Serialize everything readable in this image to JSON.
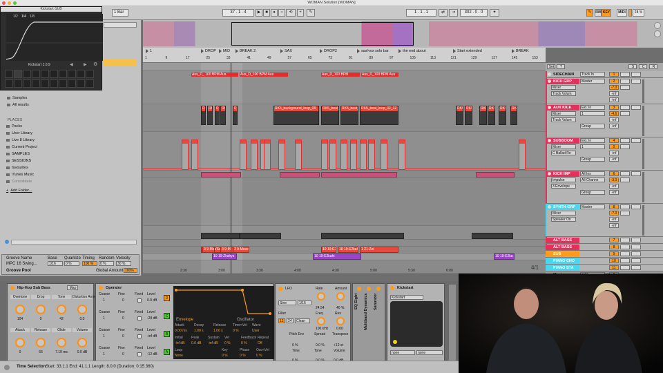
{
  "window": {
    "title": "WOMAN Solution  [WOMAN]"
  },
  "transport": {
    "bar_select": "1 Bar",
    "position": "37 .  1 .  4",
    "loop_start": "1 .  1 .  1",
    "loop_length": "302 .  0 .  0",
    "key_label": "KEY",
    "midi_label": "MIDI",
    "cpu": "28 %"
  },
  "kickstart_float": {
    "title": "Kickstart·SUB",
    "name": "Kickstart 1.0.9",
    "rate_labels": [
      "1/2",
      "1/4",
      "1/8"
    ]
  },
  "browser": {
    "search_placeholder": "",
    "items": [
      {
        "label": "Samples"
      },
      {
        "label": "All results"
      }
    ],
    "places_header": "PLACES",
    "places": [
      "Packs",
      "User Library",
      "Live 8 Library",
      "Current Project",
      "SAMPLES",
      "SESSIONS",
      "favourites",
      "iTunes Music",
      "Consolidate"
    ],
    "add_folder": "Add Folder...",
    "groove_headers": [
      "Groove Name",
      "Base",
      "Quantize",
      "Timing",
      "Random",
      "Velocity"
    ],
    "groove_row": {
      "name": "MPC 16 Swing...",
      "base": "1/16",
      "quantize": "0 %",
      "timing": "100 %",
      "random": "0 %",
      "velocity": "30 %"
    },
    "groove_pool": "Groove Pool",
    "global_amount_label": "Global Amount",
    "global_amount": "100%"
  },
  "ruler": {
    "bars": [
      "1",
      "9",
      "17",
      "25",
      "33",
      "41",
      "49",
      "57",
      "65",
      "73",
      "81",
      "89",
      "97",
      "105",
      "113",
      "121",
      "129",
      "137",
      "145",
      "153"
    ],
    "locators": [
      "1",
      "DROP",
      "MID",
      "BREAK 2",
      "SAX",
      "DROP2",
      "sax/vox solo bar",
      "the end about",
      "Start extended",
      "BREAK"
    ]
  },
  "arrangement": {
    "audio_clip_labels": [
      "Aus_D_ 100 BPM Aus",
      "Aus_D_100 BPM Aus",
      "Aus_D_100 BPM",
      "Aus_D_100 BPM Aus"
    ],
    "loop_labels": [
      "R",
      "RK5_",
      "R",
      "RK5",
      "R",
      "RK5_background_loop_08",
      "RK5_beat_",
      "RK5_beat_",
      "RK5_beat_loop_02_12",
      "RK5",
      "RK5",
      "RK5",
      "RK5",
      "RK5",
      "RK5_"
    ],
    "bottom_labels": [
      "04_Drop/Su",
      "3 9-Mos",
      "3 9-Mos",
      "3 9-Mosek",
      "10 19-E2kah",
      "10 19-E2kahi",
      "1 21-Zei",
      "10 19-Zkahys",
      "10 19-E2kahi",
      "10 19-E2ka"
    ],
    "page_counter": "4/1",
    "timeline": [
      "2:30",
      "3:00",
      "3:30",
      "4:00",
      "4:30",
      "5:00",
      "5:30",
      "6:00"
    ]
  },
  "mixer": {
    "top_buttons": [
      "Set",
      "?",
      "S",
      "C",
      "R"
    ],
    "tracks": [
      {
        "name": "SIDECHAIN",
        "color": "#e2325c",
        "input": "Track In",
        "num": "1"
      },
      {
        "name": "KICK GRP",
        "color": "#e2325c",
        "input": "Master",
        "num": "2",
        "sub": [
          "Mixer",
          "Track Volum"
        ],
        "vol": "-7.0",
        "vals": [
          "-inf",
          "-inf"
        ]
      },
      {
        "name": "AUX KICK",
        "color": "#e2325c",
        "input": "Ext. In",
        "num": "3",
        "sub": [
          "Mixer",
          "Track Volum"
        ],
        "vol": "-4.6",
        "vals": [
          "-inf",
          "-inf"
        ],
        "chan": "1",
        "grp": "Group"
      },
      {
        "name": "SUBBOOM",
        "color": "#e2325c",
        "input": "Ext. In",
        "num": "4",
        "sub": [
          "Mixer",
          "C Ballad Re"
        ],
        "vol": "0",
        "vals": [
          "-inf",
          "-inf"
        ],
        "chan": "1",
        "grp": "Group"
      },
      {
        "name": "KICK IMP",
        "color": "#e2325c",
        "input": "All Ins",
        "num": "6",
        "sub": [
          "Impulse",
          "3 Envelope"
        ],
        "vol": "-3.0",
        "vals": [
          "-inf",
          "-inf"
        ],
        "chan": "All Channe",
        "grp": "Group"
      },
      {
        "name": "SYNTH GRP",
        "color": "#4ad6ee",
        "input": "Master",
        "num": "8",
        "sub": [
          "Mixer",
          "Speaker On"
        ],
        "vol": "-7.0",
        "vals": [
          "-inf",
          "-inf"
        ]
      }
    ],
    "compact": [
      {
        "name": "ALT BASS",
        "color": "#e2325c",
        "num": "7"
      },
      {
        "name": "ALT BASS",
        "color": "#e2325c",
        "num": "8"
      },
      {
        "name": "SUB",
        "color": "#ff9b1a",
        "num": "9"
      },
      {
        "name": "PIANO CHO",
        "color": "#4ad6ee",
        "num": "10"
      },
      {
        "name": "PIANO STA",
        "color": "#4ad6ee",
        "num": "11"
      }
    ],
    "master": {
      "name": "Master",
      "input": "9/10",
      "num": "0"
    }
  },
  "devices": {
    "hhsb": {
      "title": "Hip-Hop Sub Bass",
      "map": "Map",
      "knobs": [
        {
          "label": "Overtone",
          "value": "104"
        },
        {
          "label": "Drop",
          "value": "0"
        },
        {
          "label": "Tone",
          "value": "42"
        },
        {
          "label": "Distortion Amount",
          "value": "0.0"
        },
        {
          "label": "Attack",
          "value": "0"
        },
        {
          "label": "Release",
          "value": "66"
        },
        {
          "label": "Glide",
          "value": "7.19 ms"
        },
        {
          "label": "Volume",
          "value": "0.0 dB"
        }
      ]
    },
    "operator": {
      "title": "Operator",
      "rows": [
        {
          "coarse": "Coarse",
          "fine": "Fine",
          "fixed": "Fixed",
          "level": "Level",
          "coarse_v": "1",
          "fine_v": "0",
          "level_v": "0.0 dB",
          "osc": "D"
        },
        {
          "coarse": "Coarse",
          "fine": "Fine",
          "fixed": "Fixed",
          "level": "Level",
          "coarse_v": "1",
          "fine_v": "0",
          "level_v": "-28 dB",
          "osc": "C"
        },
        {
          "coarse": "Coarse",
          "fine": "Fine",
          "fixed": "Fixed",
          "level": "Level",
          "coarse_v": "1",
          "fine_v": "0",
          "level_v": "-inf dB",
          "osc": "B"
        },
        {
          "coarse": "Coarse",
          "fine": "Fine",
          "fixed": "Fixed",
          "level": "Level",
          "coarse_v": "1",
          "fine_v": "0",
          "level_v": "-12 dB",
          "osc": "A"
        }
      ],
      "env": {
        "envelope": "Envelope",
        "oscillator": "Oscillator",
        "params": [
          "Attack",
          "Decay",
          "Release",
          "Time<Vel",
          "Wave"
        ],
        "values": [
          "0.00 ms",
          "1.00 s",
          "1.00 s",
          "0 %",
          "User"
        ],
        "params2": [
          "Initial",
          "Peak",
          "Sustain",
          "Vel",
          "Feedback",
          "Repeat"
        ],
        "values2": [
          "-inf dB",
          "0.0 dB",
          "-inf dB",
          "0 %",
          "0 %",
          "Off"
        ],
        "loop": "Loop",
        "loop_v": "None",
        "key": "Key",
        "key_v": "0 %",
        "phase": "Phase",
        "phase_v": "0 %",
        "osc_vel": "Osc<Vel",
        "osc_vel_v": "0 %",
        "q": "Q"
      }
    },
    "lfo": {
      "label": "LFO",
      "wave": "Sine",
      "rate_mode": "1/16",
      "rate_label": "Rate",
      "rate_value": "24.54",
      "amount_label": "Amount",
      "amount_value": "40 %",
      "r_label": "R",
      "filter": "Filter",
      "filter_type": "Clean",
      "filter_num": "12",
      "filter_num2": "24",
      "freq_label": "Freq",
      "freq_value": "100 kHz",
      "res_label": "Res",
      "res_value": "0.00",
      "pitch_env": "Pitch Env",
      "spread": "Spread",
      "transpose": "Transpose",
      "pitch_v": "0 %",
      "spread_v": "0.0 %",
      "transpose_v": "+12 st",
      "time": "Time",
      "tone": "Tone",
      "volume": "Volume",
      "time_v": "0 %",
      "tone_v": "0.0 %",
      "volume_v": "0.0 dB",
      "time_ot": "Time<Key",
      "time_ot_v": "0 %"
    },
    "vertical": [
      "EQ Eight",
      "Multiband Dynamics",
      "Saturator"
    ],
    "kickstart": {
      "title": "Kickstart",
      "preset": "Kickstart",
      "in_label": "none",
      "out_label": "none"
    }
  },
  "status": {
    "label": "Time Selection",
    "text": "Start: 33.1.1   End: 41.1.1   Length: 8.0.0   (Duration: 0:15.360)"
  },
  "colors": {
    "accent": "#ff9b1a",
    "clip_red": "#e64a3c",
    "clip_pink": "#c7527a",
    "cyan": "#4ad6ee",
    "selected_track": "#e2325c"
  }
}
